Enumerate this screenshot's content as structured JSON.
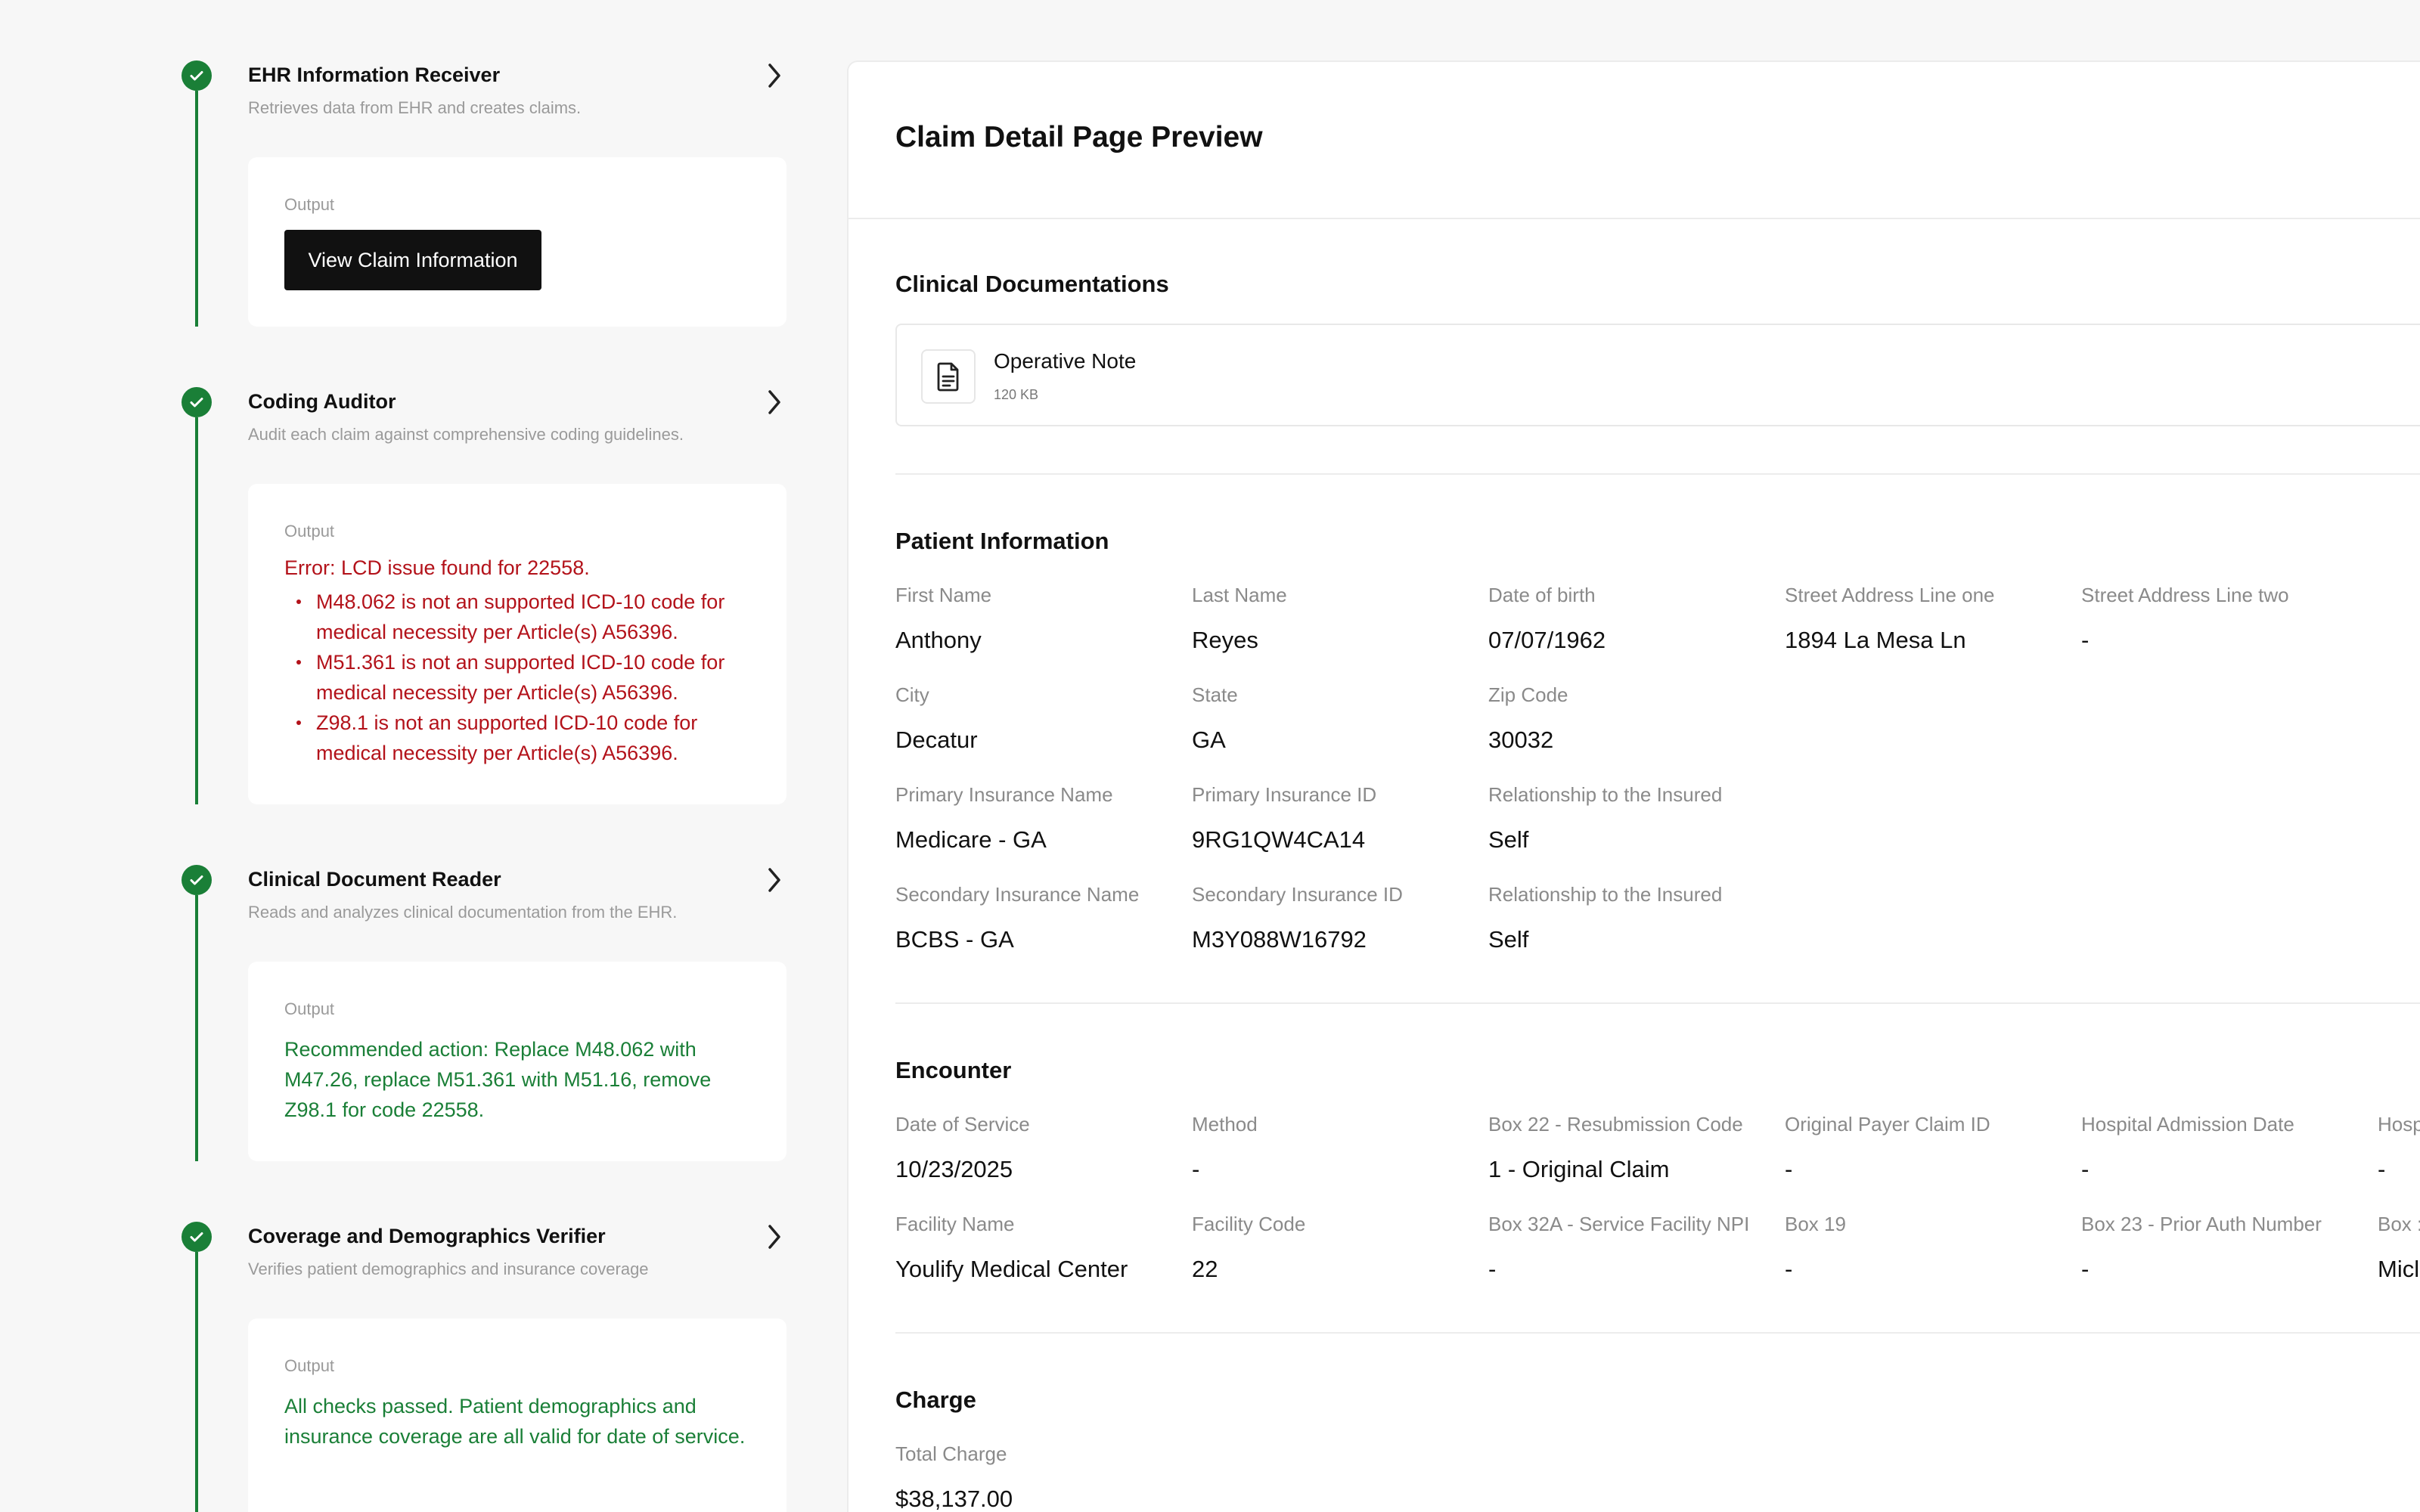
{
  "pipeline": {
    "steps": [
      {
        "title": "EHR Information Receiver",
        "description": "Retrieves data from EHR and creates claims.",
        "output_label": "Output",
        "button_label": "View Claim Information"
      },
      {
        "title": "Coding Auditor",
        "description": "Audit each claim against comprehensive coding guidelines.",
        "output_label": "Output",
        "error_title": "Error: LCD issue found for 22558.",
        "errors": [
          "M48.062 is not an supported ICD-10 code for medical necessity per Article(s) A56396.",
          "M51.361 is not an supported ICD-10 code for medical necessity per Article(s) A56396.",
          "Z98.1 is not an supported ICD-10 code for medical necessity per Article(s) A56396."
        ]
      },
      {
        "title": "Clinical Document Reader",
        "description": "Reads and analyzes clinical documentation from the EHR.",
        "output_label": "Output",
        "result": "Recommended action: Replace M48.062 with M47.26, replace M51.361 with M51.16, remove Z98.1 for code 22558."
      },
      {
        "title": "Coverage and Demographics Verifier",
        "description": "Verifies patient demographics and insurance coverage",
        "output_label": "Output",
        "result": "All checks passed. Patient demographics and insurance coverage are all valid for date of service."
      }
    ],
    "icons": {
      "status": "check-circle-icon",
      "expand": "chevron-right-icon"
    },
    "colors": {
      "success": "#1a7f37",
      "error": "#b3121a"
    }
  },
  "preview": {
    "title": "Claim Detail Page Preview",
    "clinical_docs": {
      "title": "Clinical Documentations",
      "documents": [
        {
          "name": "Operative Note",
          "size": "120 KB",
          "icon": "document-icon"
        }
      ]
    },
    "patient": {
      "title": "Patient Information",
      "rows": [
        [
          {
            "label": "First Name",
            "value": "Anthony"
          },
          {
            "label": "Last Name",
            "value": "Reyes"
          },
          {
            "label": "Date of birth",
            "value": "07/07/1962"
          },
          {
            "label": "Street Address Line one",
            "value": "1894 La Mesa Ln"
          },
          {
            "label": "Street Address Line two",
            "value": "-"
          }
        ],
        [
          {
            "label": "City",
            "value": "Decatur"
          },
          {
            "label": "State",
            "value": "GA"
          },
          {
            "label": "Zip Code",
            "value": "30032"
          }
        ],
        [
          {
            "label": "Primary Insurance Name",
            "value": "Medicare - GA"
          },
          {
            "label": "Primary Insurance ID",
            "value": "9RG1QW4CA14"
          },
          {
            "label": "Relationship to the Insured",
            "value": "Self"
          }
        ],
        [
          {
            "label": "Secondary Insurance Name",
            "value": "BCBS - GA"
          },
          {
            "label": "Secondary Insurance ID",
            "value": "M3Y088W16792"
          },
          {
            "label": "Relationship to the Insured",
            "value": "Self"
          }
        ]
      ]
    },
    "encounter": {
      "title": "Encounter",
      "rows": [
        [
          {
            "label": "Date of Service",
            "value": "10/23/2025"
          },
          {
            "label": "Method",
            "value": "-"
          },
          {
            "label": "Box 22 - Resubmission Code",
            "value": "1 - Original Claim"
          },
          {
            "label": "Original Payer Claim ID",
            "value": "-"
          },
          {
            "label": "Hospital Admission Date",
            "value": "-"
          },
          {
            "label": "Hosp",
            "value": "-"
          }
        ],
        [
          {
            "label": "Facility Name",
            "value": "Youlify Medical Center"
          },
          {
            "label": "Facility Code",
            "value": "22"
          },
          {
            "label": "Box 32A - Service Facility NPI",
            "value": "-"
          },
          {
            "label": "Box 19",
            "value": "-"
          },
          {
            "label": "Box 23 - Prior Auth Number",
            "value": "-"
          },
          {
            "label": "Box :",
            "value": "Micl"
          }
        ]
      ]
    },
    "charge": {
      "title": "Charge",
      "fields": [
        {
          "label": "Total Charge",
          "value": "$38,137.00"
        }
      ]
    }
  }
}
